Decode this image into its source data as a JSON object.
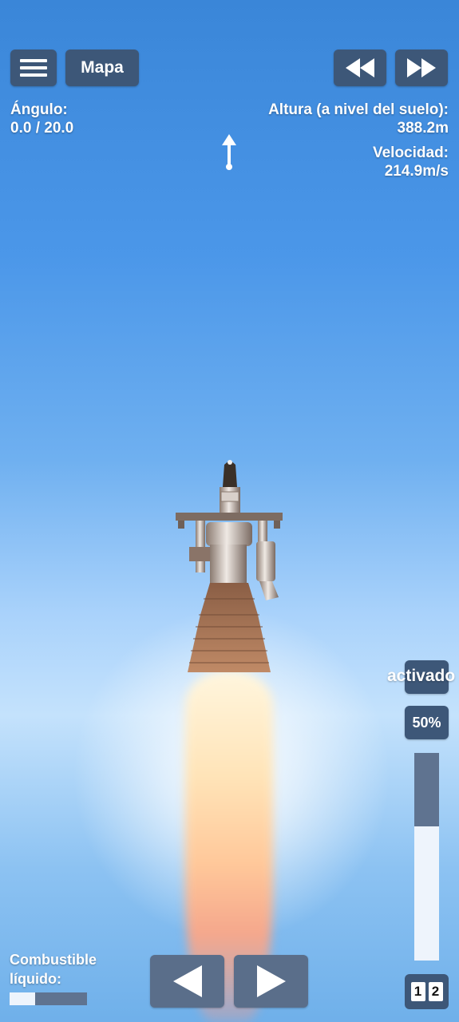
{
  "top_bar": {
    "map_label": "Mapa"
  },
  "hud": {
    "angle_label": "Ángulo:",
    "angle_value": "0.0 / 20.0",
    "altitude_label": "Altura (a nivel del suelo):",
    "altitude_value": "388.2m",
    "velocity_label": "Velocidad:",
    "velocity_value": "214.9m/s"
  },
  "controls": {
    "activated_label": "activado",
    "throttle_label": "50%",
    "throttle_level": 0.64,
    "stage_left": "1",
    "stage_right": "2"
  },
  "fuel": {
    "label": "Combustible líquido:",
    "level": 0.33
  },
  "icons": {
    "menu": "menu-icon",
    "rewind": "rewind-icon",
    "fast_forward": "fast-forward-icon",
    "heading": "heading-arrow-icon",
    "rotate_left": "rotate-left-icon",
    "rotate_right": "rotate-right-icon"
  },
  "colors": {
    "button_bg": "#3d5778",
    "sky_top": "#3a86d8",
    "sky_mid": "#c4e2fc"
  }
}
